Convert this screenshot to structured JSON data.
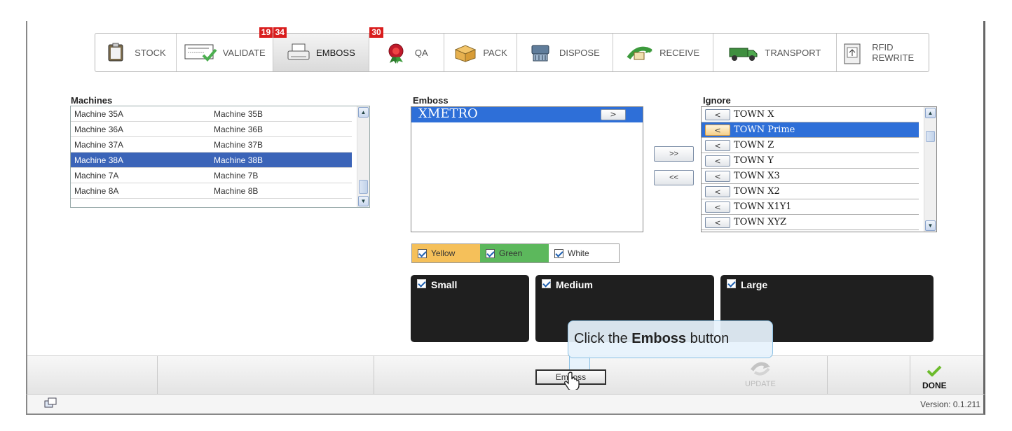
{
  "toolbar": {
    "tabs": [
      {
        "label": "STOCK",
        "badge": "",
        "icon": "clipboard-icon"
      },
      {
        "label": "VALIDATE",
        "badge": "19",
        "icon": "validate-card-icon"
      },
      {
        "label": "EMBOSS",
        "badge": "34",
        "icon": "printer-icon",
        "active": true
      },
      {
        "label": "QA",
        "badge": "30",
        "icon": "rosette-icon"
      },
      {
        "label": "PACK",
        "badge": "",
        "icon": "box-icon"
      },
      {
        "label": "DISPOSE",
        "badge": "",
        "icon": "shredder-icon"
      },
      {
        "label": "RECEIVE",
        "badge": "",
        "icon": "receive-icon"
      },
      {
        "label": "TRANSPORT",
        "badge": "",
        "icon": "truck-icon"
      },
      {
        "label": "RFID",
        "label2": "REWRITE",
        "badge": "",
        "icon": "rfid-icon"
      }
    ]
  },
  "machines": {
    "label": "Machines",
    "rows": [
      {
        "a": "Machine 35A",
        "b": "Machine 35B"
      },
      {
        "a": "Machine 36A",
        "b": "Machine 36B"
      },
      {
        "a": "Machine 37A",
        "b": "Machine 37B"
      },
      {
        "a": "Machine 38A",
        "b": "Machine 38B",
        "selected": true
      },
      {
        "a": "Machine 7A",
        "b": "Machine 7B"
      },
      {
        "a": "Machine 8A",
        "b": "Machine 8B"
      }
    ]
  },
  "emboss": {
    "label": "Emboss",
    "items": [
      "XMETRO"
    ],
    "item_button": ">",
    "move_all_right": ">>",
    "move_all_left": "<<"
  },
  "ignore": {
    "label": "Ignore",
    "item_button": "<",
    "items": [
      {
        "label": "TOWN X"
      },
      {
        "label": "TOWN Prime",
        "selected": true
      },
      {
        "label": "TOWN Z"
      },
      {
        "label": "TOWN Y"
      },
      {
        "label": "TOWN X3"
      },
      {
        "label": "TOWN X2"
      },
      {
        "label": "TOWN X1Y1"
      },
      {
        "label": "TOWN XYZ"
      }
    ]
  },
  "colors": {
    "filters": [
      {
        "label": "Yellow",
        "bg": "#f5c05a",
        "checked": true
      },
      {
        "label": "Green",
        "bg": "#5cb85c",
        "checked": true
      },
      {
        "label": "White",
        "bg": "#ffffff",
        "checked": true
      }
    ]
  },
  "sizes": [
    {
      "label": "Small",
      "checked": true
    },
    {
      "label": "Medium",
      "checked": true
    },
    {
      "label": "Large",
      "checked": true
    }
  ],
  "callout": {
    "prefix": "Click the ",
    "bold": "Emboss",
    "suffix": " button"
  },
  "bottom": {
    "emboss_button": "Emboss",
    "update_label": "UPDATE",
    "done_label": "DONE",
    "version": "Version: 0.1.211"
  }
}
